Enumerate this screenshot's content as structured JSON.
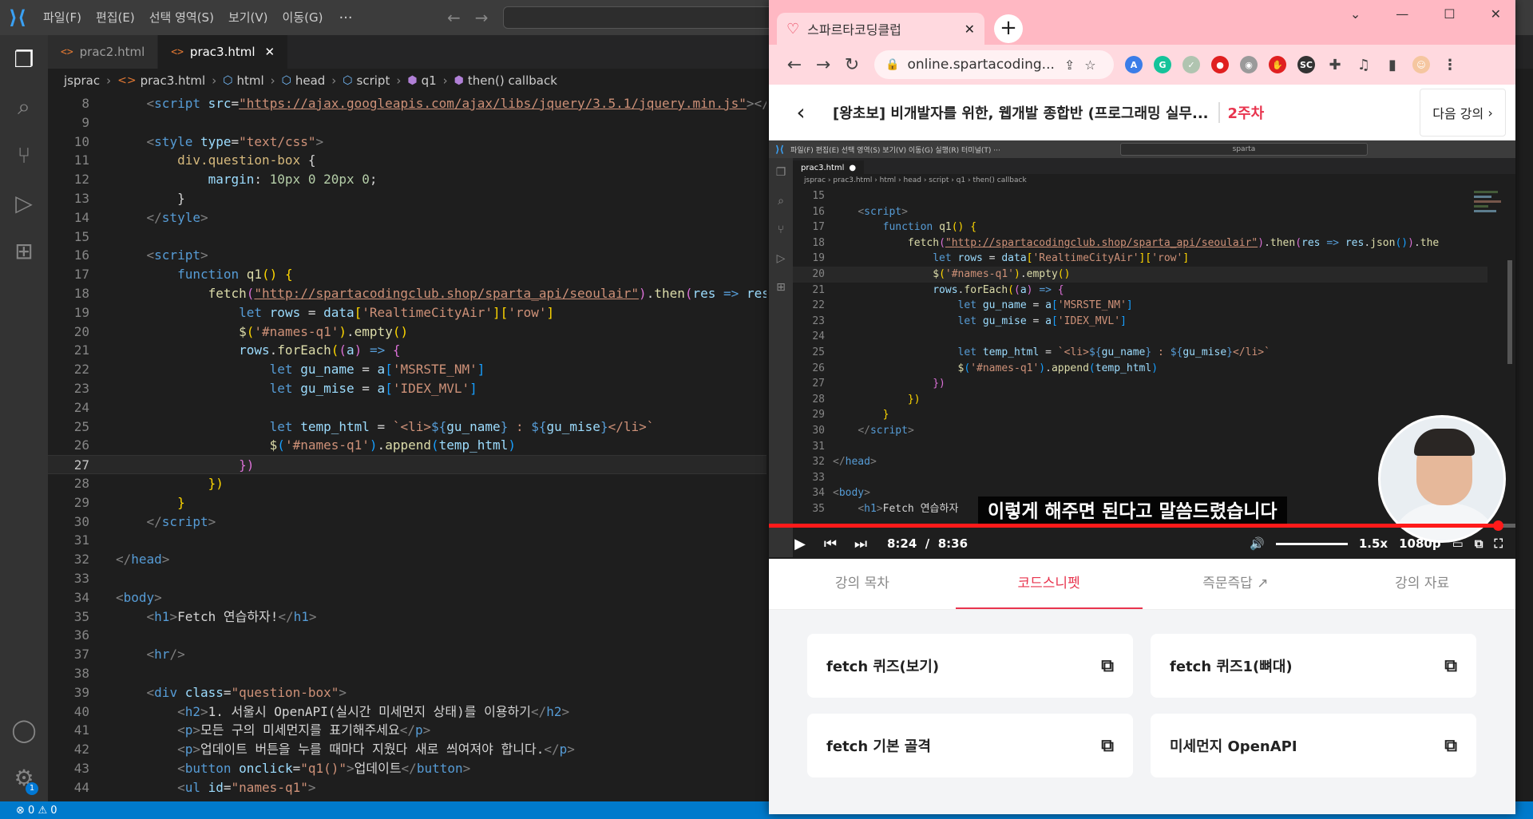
{
  "vscode": {
    "menu": [
      "파일(F)",
      "편집(E)",
      "선택 영역(S)",
      "보기(V)",
      "이동(G)"
    ],
    "tabs": [
      {
        "label": "prac2.html"
      },
      {
        "label": "prac3.html"
      }
    ],
    "breadcrumb": [
      "jsprac",
      "prac3.html",
      "html",
      "head",
      "script",
      "q1",
      "then() callback"
    ],
    "status": {
      "errors": "0",
      "warnings": "0"
    },
    "accounts_badge": "1",
    "lines": [
      {
        "n": "8",
        "html": "    <span class='t-tag'>&lt;</span><span class='t-name'>script</span> <span class='t-attr'>src</span>=<span class='t-url'>\"https://ajax.googleapis.com/ajax/libs/jquery/3.5.1/jquery.min.js\"</span><span class='t-tag'>&gt;&lt;/</span>"
      },
      {
        "n": "9",
        "html": ""
      },
      {
        "n": "10",
        "html": "    <span class='t-tag'>&lt;</span><span class='t-name'>style</span> <span class='t-attr'>type</span>=<span class='t-str'>\"text/css\"</span><span class='t-tag'>&gt;</span>"
      },
      {
        "n": "11",
        "html": "        <span class='t-sel'>div.question-box</span> {"
      },
      {
        "n": "12",
        "html": "            <span class='t-prop'>margin</span>: <span class='t-num'>10px 0 20px 0</span>;"
      },
      {
        "n": "13",
        "html": "        }"
      },
      {
        "n": "14",
        "html": "    <span class='t-tag'>&lt;/</span><span class='t-name'>style</span><span class='t-tag'>&gt;</span>"
      },
      {
        "n": "15",
        "html": ""
      },
      {
        "n": "16",
        "html": "    <span class='t-tag'>&lt;</span><span class='t-name'>script</span><span class='t-tag'>&gt;</span>"
      },
      {
        "n": "17",
        "html": "        <span class='t-kw'>function</span> <span class='t-fn'>q1</span><span class='t-br1'>()</span> <span class='t-br1'>{</span>"
      },
      {
        "n": "18",
        "html": "            <span class='t-fn'>fetch</span><span class='t-br2'>(</span><span class='t-url'>\"http://spartacodingclub.shop/sparta_api/seoulair\"</span><span class='t-br2'>)</span>.<span class='t-fn'>then</span><span class='t-br2'>(</span><span class='t-var'>res</span> <span class='t-kw'>=&gt;</span> <span class='t-var'>res</span>"
      },
      {
        "n": "19",
        "html": "                <span class='t-kw'>let</span> <span class='t-var'>rows</span> = <span class='t-var'>data</span><span class='t-br1'>[</span><span class='t-str'>'RealtimeCityAir'</span><span class='t-br1'>][</span><span class='t-str'>'row'</span><span class='t-br1'>]</span>"
      },
      {
        "n": "20",
        "html": "                <span class='t-fn'>$</span><span class='t-br1'>(</span><span class='t-str'>'#names-q1'</span><span class='t-br1'>)</span>.<span class='t-fn'>empty</span><span class='t-br1'>()</span>"
      },
      {
        "n": "21",
        "html": "                <span class='t-var'>rows</span>.<span class='t-fn'>forEach</span><span class='t-br1'>(</span><span class='t-br2'>(</span><span class='t-var'>a</span><span class='t-br2'>)</span> <span class='t-kw'>=&gt;</span> <span class='t-br2'>{</span>"
      },
      {
        "n": "22",
        "html": "                    <span class='t-kw'>let</span> <span class='t-var'>gu_name</span> = <span class='t-var'>a</span><span class='t-br3'>[</span><span class='t-str'>'MSRSTE_NM'</span><span class='t-br3'>]</span>"
      },
      {
        "n": "23",
        "html": "                    <span class='t-kw'>let</span> <span class='t-var'>gu_mise</span> = <span class='t-var'>a</span><span class='t-br3'>[</span><span class='t-str'>'IDEX_MVL'</span><span class='t-br3'>]</span>"
      },
      {
        "n": "24",
        "html": ""
      },
      {
        "n": "25",
        "html": "                    <span class='t-kw'>let</span> <span class='t-var'>temp_html</span> = <span class='t-tpl'>`&lt;li&gt;</span><span class='t-kw'>${</span><span class='t-var'>gu_name</span><span class='t-kw'>}</span><span class='t-tpl'> : </span><span class='t-kw'>${</span><span class='t-var'>gu_mise</span><span class='t-kw'>}</span><span class='t-tpl'>&lt;/li&gt;`</span>"
      },
      {
        "n": "26",
        "html": "                    <span class='t-fn'>$</span><span class='t-br3'>(</span><span class='t-str'>'#names-q1'</span><span class='t-br3'>)</span>.<span class='t-fn'>append</span><span class='t-br3'>(</span><span class='t-var'>temp_html</span><span class='t-br3'>)</span>"
      },
      {
        "n": "27",
        "html": "                <span class='t-br2'>})</span>",
        "current": true
      },
      {
        "n": "28",
        "html": "            <span class='t-br1'>})</span>"
      },
      {
        "n": "29",
        "html": "        <span class='t-br1'>}</span>"
      },
      {
        "n": "30",
        "html": "    <span class='t-tag'>&lt;/</span><span class='t-name'>script</span><span class='t-tag'>&gt;</span>"
      },
      {
        "n": "31",
        "html": ""
      },
      {
        "n": "32",
        "html": "<span class='t-tag'>&lt;/</span><span class='t-name'>head</span><span class='t-tag'>&gt;</span>"
      },
      {
        "n": "33",
        "html": ""
      },
      {
        "n": "34",
        "html": "<span class='t-tag'>&lt;</span><span class='t-name'>body</span><span class='t-tag'>&gt;</span>"
      },
      {
        "n": "35",
        "html": "    <span class='t-tag'>&lt;</span><span class='t-name'>h1</span><span class='t-tag'>&gt;</span>Fetch 연습하자!<span class='t-tag'>&lt;/</span><span class='t-name'>h1</span><span class='t-tag'>&gt;</span>"
      },
      {
        "n": "36",
        "html": ""
      },
      {
        "n": "37",
        "html": "    <span class='t-tag'>&lt;</span><span class='t-name'>hr</span><span class='t-tag'>/&gt;</span>"
      },
      {
        "n": "38",
        "html": ""
      },
      {
        "n": "39",
        "html": "    <span class='t-tag'>&lt;</span><span class='t-name'>div</span> <span class='t-attr'>class</span>=<span class='t-str'>\"question-box\"</span><span class='t-tag'>&gt;</span>"
      },
      {
        "n": "40",
        "html": "        <span class='t-tag'>&lt;</span><span class='t-name'>h2</span><span class='t-tag'>&gt;</span>1. 서울시 OpenAPI(실시간 미세먼지 상태)를 이용하기<span class='t-tag'>&lt;/</span><span class='t-name'>h2</span><span class='t-tag'>&gt;</span>"
      },
      {
        "n": "41",
        "html": "        <span class='t-tag'>&lt;</span><span class='t-name'>p</span><span class='t-tag'>&gt;</span>모든 구의 미세먼지를 표기해주세요<span class='t-tag'>&lt;/</span><span class='t-name'>p</span><span class='t-tag'>&gt;</span>"
      },
      {
        "n": "42",
        "html": "        <span class='t-tag'>&lt;</span><span class='t-name'>p</span><span class='t-tag'>&gt;</span>업데이트 버튼을 누를 때마다 지웠다 새로 씌여져야 합니다.<span class='t-tag'>&lt;/</span><span class='t-name'>p</span><span class='t-tag'>&gt;</span>"
      },
      {
        "n": "43",
        "html": "        <span class='t-tag'>&lt;</span><span class='t-name'>button</span> <span class='t-attr'>onclick</span>=<span class='t-str'>\"q1()\"</span><span class='t-tag'>&gt;</span>업데이트<span class='t-tag'>&lt;/</span><span class='t-name'>button</span><span class='t-tag'>&gt;</span>"
      },
      {
        "n": "44",
        "html": "        <span class='t-tag'>&lt;</span><span class='t-name'>ul</span> <span class='t-attr'>id</span>=<span class='t-str'>\"names-q1\"</span><span class='t-tag'>&gt;</span>"
      }
    ]
  },
  "browser": {
    "tab_title": "스파르타코딩클럽",
    "url": "online.spartacoding...",
    "course_title": "[왕초보] 비개발자를 위한, 웹개발 종합반 (프로그래밍 실무...",
    "week": "2주차",
    "next_lesson": "다음 강의",
    "video": {
      "time_current": "8:24",
      "time_sep": "/",
      "time_total": "8:36",
      "progress": 0.977,
      "speed": "1.5x",
      "quality": "1080p",
      "subtitle": "이렇게 해주면 된다고 말씀드렸습니다",
      "inner": {
        "menu": "파일(F)  편집(E)  선택 영역(S)  보기(V)  이동(G)  실행(R)  터미널(T)  ···",
        "search": "sparta",
        "tab": "prac3.html",
        "breadcrumb": "jsprac › prac3.html › html › head › script › q1 › then() callback",
        "lines": [
          {
            "n": "15",
            "html": ""
          },
          {
            "n": "16",
            "html": "    <span class='t-tag'>&lt;</span><span class='t-name'>script</span><span class='t-tag'>&gt;</span>"
          },
          {
            "n": "17",
            "html": "        <span class='t-kw'>function</span> <span class='t-fn'>q1</span><span class='t-br1'>()</span> <span class='t-br1'>{</span>"
          },
          {
            "n": "18",
            "html": "            <span class='t-fn'>fetch</span><span class='t-br2'>(</span><span class='t-url'>\"http://spartacodingclub.shop/sparta_api/seoulair\"</span><span class='t-br2'>)</span>.<span class='t-fn'>then</span><span class='t-br2'>(</span><span class='t-var'>res</span> <span class='t-kw'>=&gt;</span> <span class='t-var'>res</span>.<span class='t-fn'>json</span><span class='t-br3'>()</span><span class='t-br2'>)</span>.<span class='t-fn'>the</span>"
          },
          {
            "n": "19",
            "html": "                <span class='t-kw'>let</span> <span class='t-var'>rows</span> = <span class='t-var'>data</span><span class='t-br1'>[</span><span class='t-str'>'RealtimeCityAir'</span><span class='t-br1'>][</span><span class='t-str'>'row'</span><span class='t-br1'>]</span>"
          },
          {
            "n": "20",
            "html": "                <span class='t-fn'>$</span><span class='t-br1'>(</span><span class='t-str'>'#names-q1'</span><span class='t-br1'>)</span>.<span class='t-fn'>empty</span><span class='t-br1'>()</span>",
            "current": true
          },
          {
            "n": "21",
            "html": "                <span class='t-var'>rows</span>.<span class='t-fn'>forEach</span><span class='t-br1'>(</span><span class='t-br2'>(</span><span class='t-var'>a</span><span class='t-br2'>)</span> <span class='t-kw'>=&gt;</span> <span class='t-br2'>{</span>"
          },
          {
            "n": "22",
            "html": "                    <span class='t-kw'>let</span> <span class='t-var'>gu_name</span> = <span class='t-var'>a</span><span class='t-br3'>[</span><span class='t-str'>'MSRSTE_NM'</span><span class='t-br3'>]</span>"
          },
          {
            "n": "23",
            "html": "                    <span class='t-kw'>let</span> <span class='t-var'>gu_mise</span> = <span class='t-var'>a</span><span class='t-br3'>[</span><span class='t-str'>'IDEX_MVL'</span><span class='t-br3'>]</span>"
          },
          {
            "n": "24",
            "html": ""
          },
          {
            "n": "25",
            "html": "                    <span class='t-kw'>let</span> <span class='t-var'>temp_html</span> = <span class='t-tpl'>`&lt;li&gt;</span><span class='t-kw'>${</span><span class='t-var'>gu_name</span><span class='t-kw'>}</span><span class='t-tpl'> : </span><span class='t-kw'>${</span><span class='t-var'>gu_mise</span><span class='t-kw'>}</span><span class='t-tpl'>&lt;/li&gt;`</span>"
          },
          {
            "n": "26",
            "html": "                    <span class='t-fn'>$</span><span class='t-br3'>(</span><span class='t-str'>'#names-q1'</span><span class='t-br3'>)</span>.<span class='t-fn'>append</span><span class='t-br3'>(</span><span class='t-var'>temp_html</span><span class='t-br3'>)</span>"
          },
          {
            "n": "27",
            "html": "                <span class='t-br2'>})</span>"
          },
          {
            "n": "28",
            "html": "            <span class='t-br1'>})</span>"
          },
          {
            "n": "29",
            "html": "        <span class='t-br1'>}</span>"
          },
          {
            "n": "30",
            "html": "    <span class='t-tag'>&lt;/</span><span class='t-name'>script</span><span class='t-tag'>&gt;</span>"
          },
          {
            "n": "31",
            "html": ""
          },
          {
            "n": "32",
            "html": "<span class='t-tag'>&lt;/</span><span class='t-name'>head</span><span class='t-tag'>&gt;</span>"
          },
          {
            "n": "33",
            "html": ""
          },
          {
            "n": "34",
            "html": "<span class='t-tag'>&lt;</span><span class='t-name'>body</span><span class='t-tag'>&gt;</span>"
          },
          {
            "n": "35",
            "html": "    <span class='t-tag'>&lt;</span><span class='t-name'>h1</span><span class='t-tag'>&gt;</span>Fetch 연습하자"
          }
        ]
      }
    },
    "lecture_tabs": [
      {
        "label": "강의 목차"
      },
      {
        "label": "코드스니펫",
        "active": true
      },
      {
        "label": "즉문즉답 ↗"
      },
      {
        "label": "강의 자료"
      }
    ],
    "snippets": [
      "fetch 퀴즈(보기)",
      "fetch 퀴즈1(뼈대)",
      "fetch 기본 골격",
      "미세먼지 OpenAPI"
    ]
  },
  "colors": {
    "accent": "#e8344e",
    "vscode_blue": "#007acc",
    "browser_frame": "#ffb8c3"
  }
}
